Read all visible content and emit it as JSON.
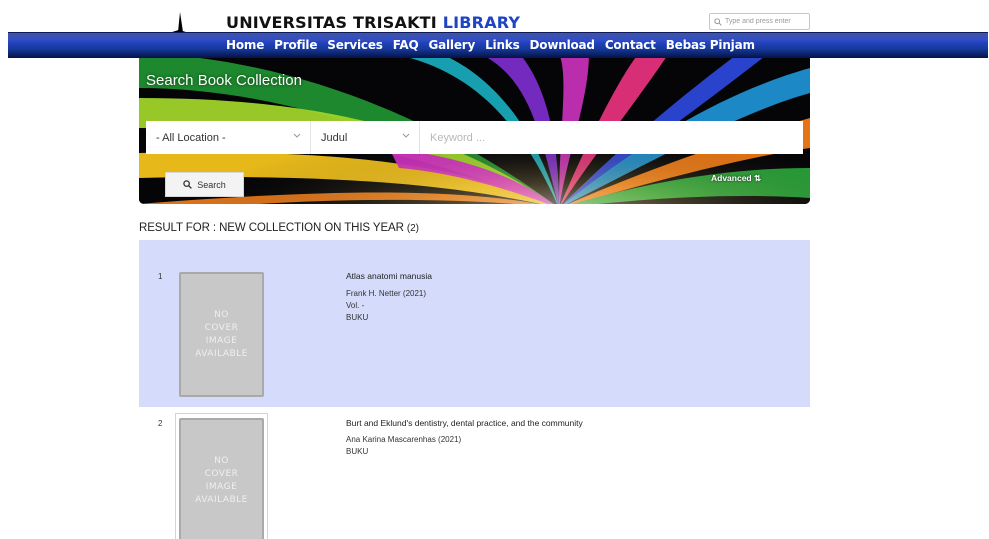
{
  "header": {
    "brand_main": "UNIVERSITAS TRISAKTI ",
    "brand_accent": "LIBRARY",
    "search_placeholder": "Type and press enter"
  },
  "nav": [
    {
      "label": "Home"
    },
    {
      "label": "Profile"
    },
    {
      "label": "Services"
    },
    {
      "label": "FAQ"
    },
    {
      "label": "Gallery"
    },
    {
      "label": "Links"
    },
    {
      "label": "Download"
    },
    {
      "label": "Contact"
    },
    {
      "label": "Bebas Pinjam"
    }
  ],
  "search_panel": {
    "title": "Search Book Collection",
    "location_value": "- All Location -",
    "type_value": "Judul",
    "keyword_placeholder": "Keyword ...",
    "search_button": "Search",
    "advanced_label": "Advanced ⇅"
  },
  "results": {
    "heading": "RESULT FOR : NEW COLLECTION ON THIS YEAR",
    "count": "(2)",
    "no_cover_text": "NO\nCOVER\nIMAGE\nAVAILABLE",
    "items": [
      {
        "number": "1",
        "title": "Atlas anatomi manusia",
        "author": "Frank H. Netter (2021)",
        "volume": "Vol. -",
        "type": "BUKU"
      },
      {
        "number": "2",
        "title": "Burt and Eklund's dentistry, dental practice, and the community",
        "author": "Ana Karina Mascarenhas (2021)",
        "type": "BUKU"
      }
    ]
  },
  "colors": {
    "nav_blue": "#2846c8",
    "brand_blue": "#1e43c4",
    "result_highlight": "#d5dbfb"
  }
}
